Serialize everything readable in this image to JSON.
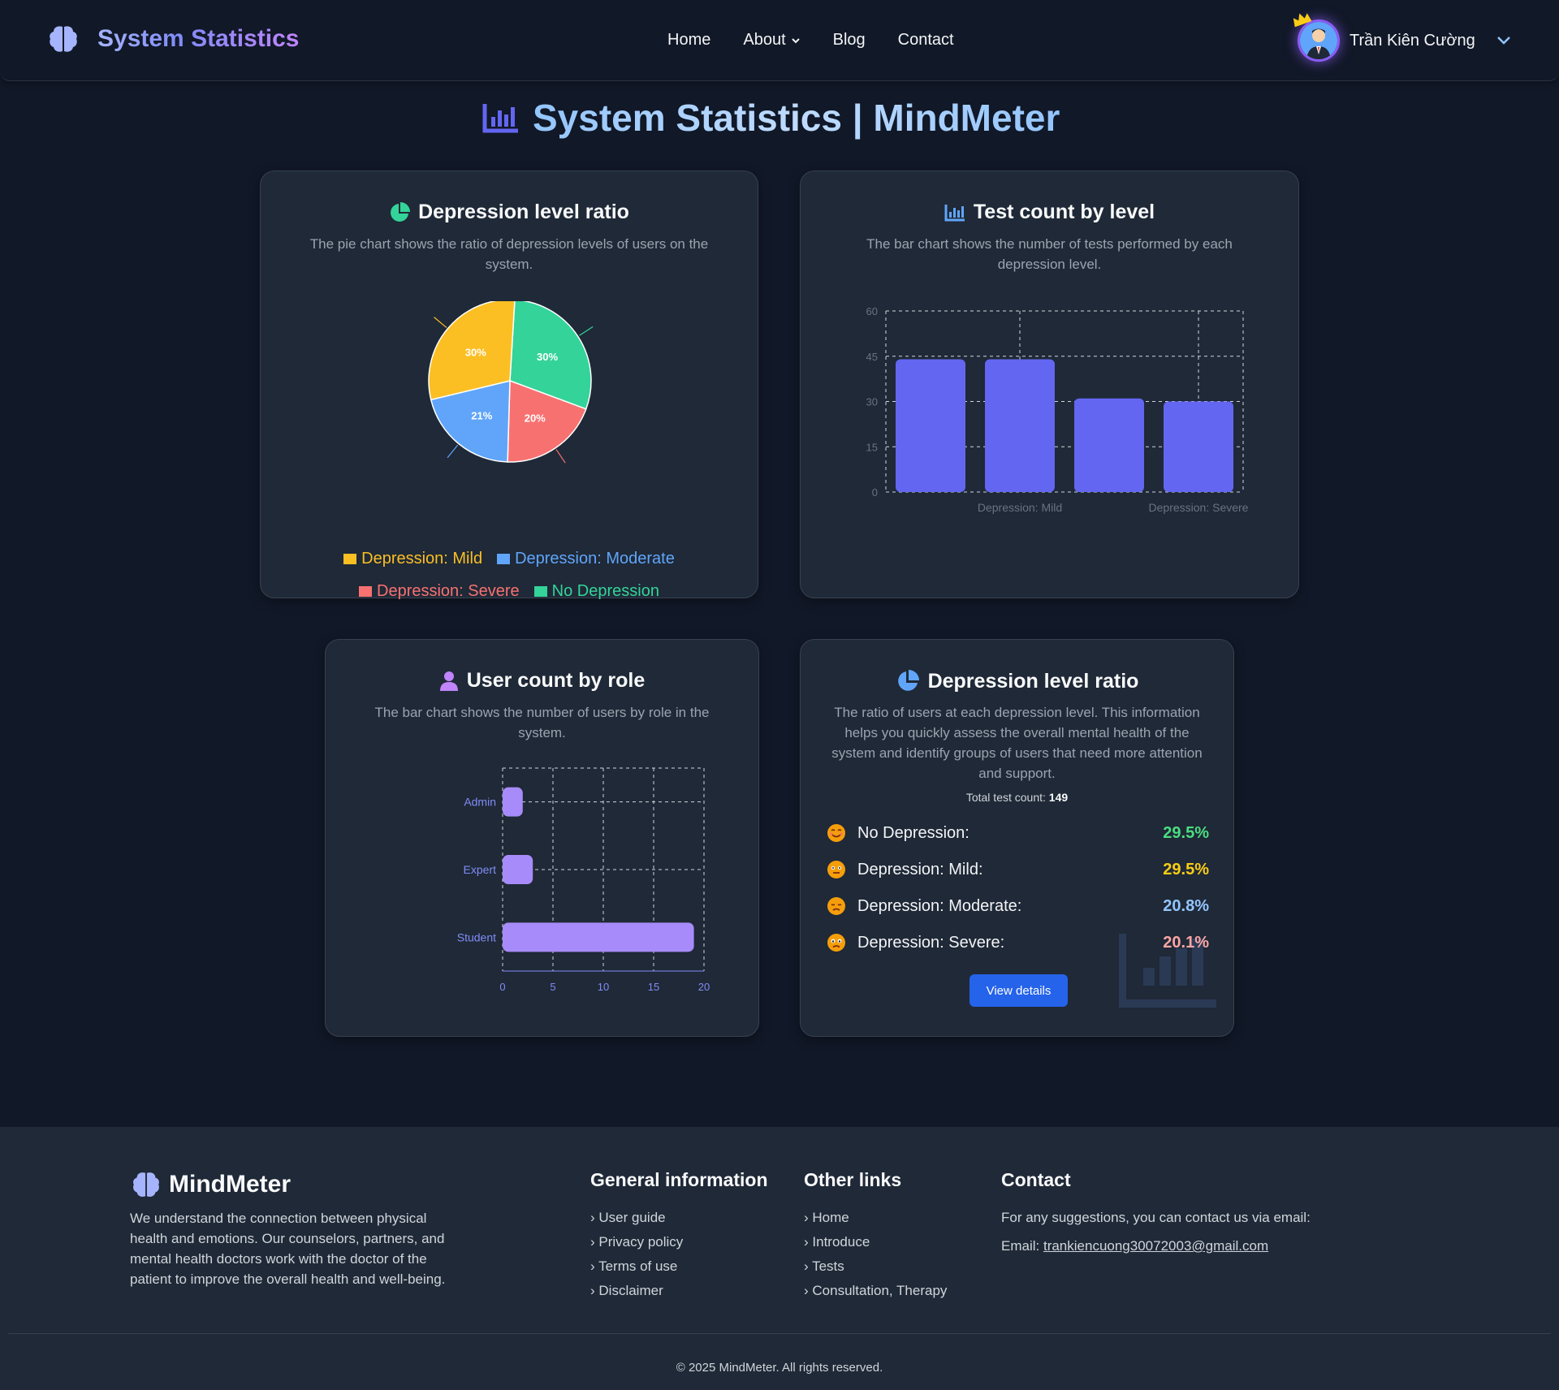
{
  "navbar": {
    "brand": "System Statistics",
    "brand_icon": "brain-icon",
    "links": [
      {
        "label": "Home"
      },
      {
        "label": "About"
      },
      {
        "label": "Blog"
      },
      {
        "label": "Contact"
      }
    ],
    "user_name": "Trần Kiên Cường"
  },
  "page": {
    "title": "System Statistics | MindMeter",
    "title_icon": "bar-chart-icon"
  },
  "cards": {
    "pie": {
      "title": "Depression level ratio",
      "description": "The pie chart shows the ratio of depression levels of users on the system.",
      "legend": [
        {
          "label": "Depression: Mild",
          "color": "#fbbf24"
        },
        {
          "label": "Depression: Moderate",
          "color": "#60a5fa"
        },
        {
          "label": "Depression: Severe",
          "color": "#f87171"
        },
        {
          "label": "No Depression",
          "color": "#34d399"
        }
      ]
    },
    "bar": {
      "title": "Test count by level",
      "description": "The bar chart shows the number of tests performed by each depression level."
    },
    "role": {
      "title": "User count by role",
      "description": "The bar chart shows the number of users by role in the system."
    },
    "summary": {
      "title": "Depression level ratio",
      "description": "The ratio of users at each depression level. This information helps you quickly assess the overall mental health of the system and identify groups of users that need more attention and support.",
      "total_label": "Total test count:",
      "total_value": "149",
      "rows": [
        {
          "label": "No Depression:",
          "value": "29.5%",
          "color": "#4ade80",
          "emoji": "smiling-face-icon"
        },
        {
          "label": "Depression: Mild:",
          "value": "29.5%",
          "color": "#facc15",
          "emoji": "neutral-face-icon"
        },
        {
          "label": "Depression: Moderate:",
          "value": "20.8%",
          "color": "#93c5fd",
          "emoji": "sad-face-icon"
        },
        {
          "label": "Depression: Severe:",
          "value": "20.1%",
          "color": "#fca5a5",
          "emoji": "distressed-face-icon"
        }
      ],
      "button": "View details"
    }
  },
  "chart_data": [
    {
      "type": "pie",
      "labels": [
        "Depression: Mild",
        "Depression: Moderate",
        "Depression: Severe",
        "No Depression"
      ],
      "values": [
        30,
        21,
        20,
        30
      ],
      "value_labels": [
        "30%",
        "21%",
        "20%",
        "30%"
      ],
      "colors": [
        "#fbbf24",
        "#60a5fa",
        "#f87171",
        "#34d399"
      ],
      "legend_position": "bottom"
    },
    {
      "type": "bar",
      "categories": [
        "",
        "Depression: Mild",
        "",
        "Depression: Severe"
      ],
      "values": [
        44,
        44,
        31,
        30
      ],
      "ylim": [
        0,
        60
      ],
      "yticks": [
        "0",
        "15",
        "30",
        "45",
        "60"
      ],
      "grid": true,
      "color": "#6366f1"
    },
    {
      "type": "bar",
      "orientation": "horizontal",
      "categories": [
        "Admin",
        "Expert",
        "Student"
      ],
      "values": [
        2,
        3,
        19
      ],
      "xlim": [
        0,
        20
      ],
      "xticks": [
        "0",
        "5",
        "10",
        "15",
        "20"
      ],
      "grid": true,
      "color": "#a78bfa"
    }
  ],
  "footer": {
    "brand": "MindMeter",
    "about": "We understand the connection between physical health and emotions. Our counselors, partners, and mental health doctors work with the doctor of the patient to improve the overall health and well-being.",
    "general": {
      "title": "General information",
      "links": [
        "User guide",
        "Privacy policy",
        "Terms of use",
        "Disclaimer"
      ]
    },
    "other": {
      "title": "Other links",
      "links": [
        "Home",
        "Introduce",
        "Tests",
        "Consultation, Therapy"
      ]
    },
    "contact": {
      "title": "Contact",
      "text": "For any suggestions, you can contact us via email:",
      "email_label": "Email:",
      "email": "trankiencuong30072003@gmail.com"
    },
    "copyright": "© 2025 MindMeter. All rights reserved."
  }
}
